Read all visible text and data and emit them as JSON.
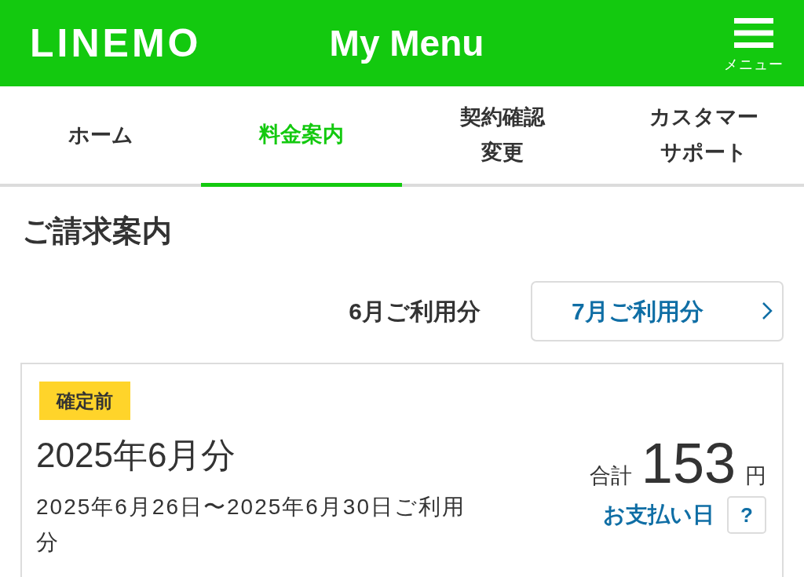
{
  "header": {
    "logo": "LINEMO",
    "title": "My Menu",
    "menu_label": "メニュー"
  },
  "tabs": [
    {
      "lines": [
        "ホーム"
      ],
      "selected": false
    },
    {
      "lines": [
        "料金案内"
      ],
      "selected": true
    },
    {
      "lines": [
        "契約確認",
        "変更"
      ],
      "selected": false
    },
    {
      "lines": [
        "カスタマー",
        "サポート"
      ],
      "selected": false
    }
  ],
  "billing": {
    "heading": "ご請求案内",
    "current_month": "6月ご利用分",
    "next_month_button": "7月ご利用分",
    "card": {
      "status_badge": "確定前",
      "period_title": "2025年6月分",
      "usage_period": "2025年6月26日〜2025年6月30日ご利用分",
      "total_label": "合計",
      "total_amount": "153",
      "currency": "円",
      "payment_date_link": "お支払い日",
      "help_button": "?"
    }
  }
}
